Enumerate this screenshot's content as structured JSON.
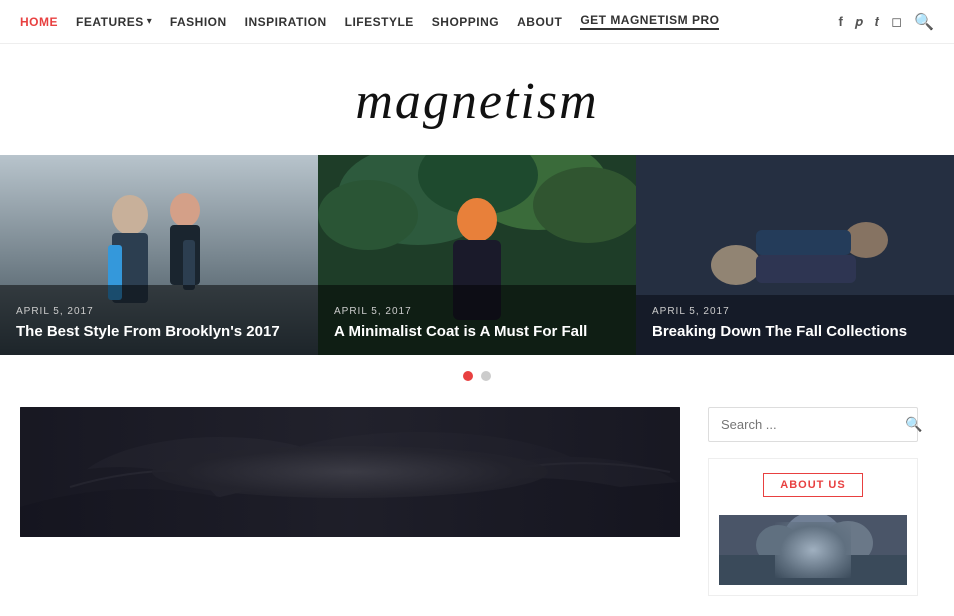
{
  "nav": {
    "links": [
      {
        "label": "HOME",
        "active": true,
        "id": "home"
      },
      {
        "label": "FEATURES",
        "active": false,
        "id": "features",
        "hasDropdown": true
      },
      {
        "label": "FASHION",
        "active": false,
        "id": "fashion"
      },
      {
        "label": "INSPIRATION",
        "active": false,
        "id": "inspiration"
      },
      {
        "label": "LIFESTYLE",
        "active": false,
        "id": "lifestyle"
      },
      {
        "label": "SHOPPING",
        "active": false,
        "id": "shopping"
      },
      {
        "label": "ABOUT",
        "active": false,
        "id": "about"
      },
      {
        "label": "GET MAGNETISM PRO",
        "active": false,
        "id": "pro",
        "isPro": true
      }
    ],
    "social": [
      {
        "icon": "f",
        "name": "facebook",
        "symbol": "𝐟"
      },
      {
        "icon": "p",
        "name": "pinterest",
        "symbol": "𝐩"
      },
      {
        "icon": "t",
        "name": "twitter",
        "symbol": "𝐭"
      },
      {
        "icon": "i",
        "name": "instagram",
        "symbol": "📷"
      }
    ]
  },
  "logo": {
    "text": "magnetism"
  },
  "slider": {
    "slides": [
      {
        "date": "APRIL 5, 2017",
        "title": "The Best Style From Brooklyn's 2017",
        "id": "slide-1"
      },
      {
        "date": "APRIL 5, 2017",
        "title": "A Minimalist Coat is A Must For Fall",
        "id": "slide-2"
      },
      {
        "date": "APRIL 5, 2017",
        "title": "Breaking Down The Fall Collections",
        "id": "slide-3"
      }
    ],
    "dots": [
      {
        "active": true
      },
      {
        "active": false
      }
    ]
  },
  "sidebar": {
    "search_placeholder": "Search ...",
    "search_button_label": "🔍",
    "about_us_label": "ABOUT US"
  }
}
